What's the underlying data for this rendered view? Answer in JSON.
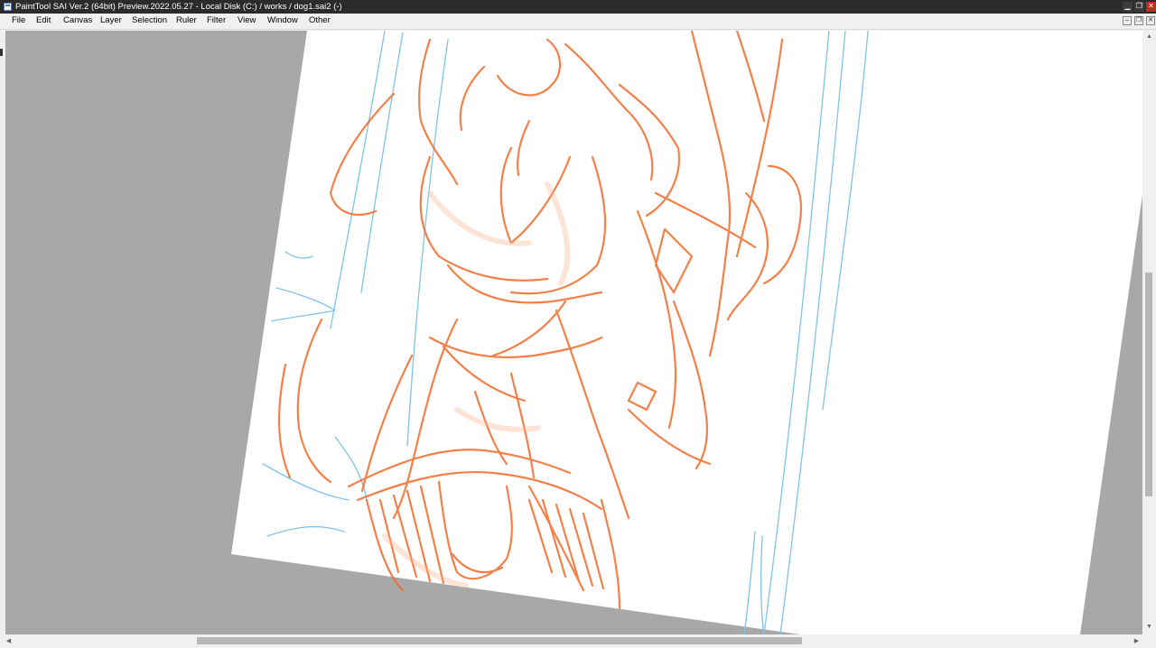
{
  "window": {
    "title": "PaintTool SAI Ver.2 (64bit) Preview.2022.05.27 - Local Disk (C:) / works / dog1.sai2 (-)",
    "controls": {
      "minimize": "▁",
      "maximize": "❐",
      "close": "✕"
    }
  },
  "menu": {
    "items": [
      "File",
      "Edit",
      "Canvas",
      "Layer",
      "Selection",
      "Ruler",
      "Filter",
      "View",
      "Window",
      "Other"
    ]
  },
  "document_controls": {
    "minimize": "–",
    "restore": "❐",
    "close": "✕"
  },
  "canvas": {
    "background_color": "#a8a8a8",
    "paper_color": "#ffffff",
    "sketch_color": "#f26b2a",
    "guide_color": "#7fc4e6",
    "rotated": true
  },
  "scrollbars": {
    "up_arrow": "▲",
    "down_arrow": "▼",
    "left_arrow": "◀",
    "right_arrow": "▶"
  }
}
